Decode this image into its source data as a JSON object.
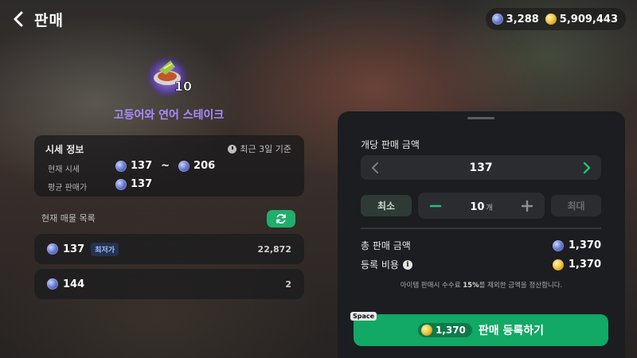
{
  "header": {
    "title": "판매",
    "blue_currency": "3,288",
    "gold_currency": "5,909,443"
  },
  "item": {
    "name": "고등어와 연어 스테이크",
    "stack_count": "10"
  },
  "market_info": {
    "title": "시세 정보",
    "period": "최근 3일 기준",
    "current_label": "현재 시세",
    "current_min": "137",
    "range_sep": "~",
    "current_max": "206",
    "average_label": "평균 판매가",
    "average_value": "137"
  },
  "listings": {
    "title": "현재 매물 목록",
    "rows": [
      {
        "price": "137",
        "badge": "최저가",
        "quantity": "22,872"
      },
      {
        "price": "144",
        "badge": "",
        "quantity": "2"
      }
    ]
  },
  "sell_panel": {
    "unit_price_label": "개당 판매 금액",
    "unit_price": "137",
    "min_label": "최소",
    "max_label": "최대",
    "quantity": "10",
    "quantity_unit": "개",
    "total_label": "총 판매 금액",
    "total_value": "1,370",
    "fee_label": "등록 비용",
    "fee_value": "1,370",
    "notice_before": "아이템 판매시 수수료 ",
    "notice_pct": "15%",
    "notice_after": "를 제외한 금액을 정산합니다.",
    "cta_cost": "1,370",
    "cta_label": "판매 등록하기",
    "hotkey": "Space"
  },
  "colors": {
    "accent_green": "#12a866",
    "item_name_purple": "#a98cff"
  },
  "icons": [
    "back-arrow-icon",
    "blue-coin-icon",
    "gold-coin-icon",
    "clock-icon",
    "refresh-icon",
    "chevron-left-icon",
    "chevron-right-icon",
    "minus-icon",
    "plus-icon",
    "info-icon"
  ]
}
